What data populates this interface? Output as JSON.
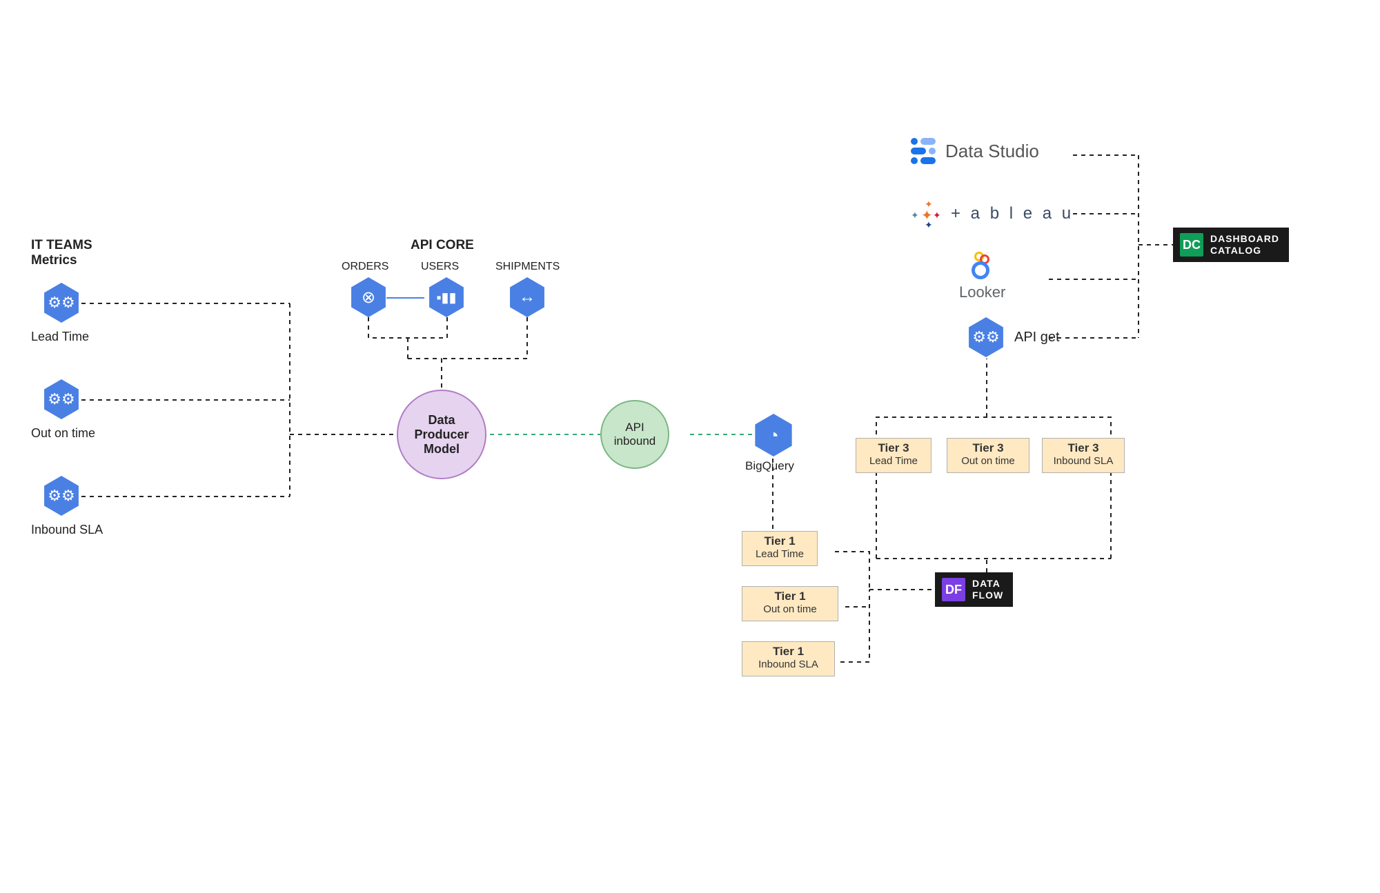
{
  "it_teams": {
    "title_line1": "IT TEAMS",
    "title_line2": "Metrics",
    "metrics": [
      {
        "label": "Lead Time"
      },
      {
        "label": "Out on time"
      },
      {
        "label": "Inbound SLA"
      }
    ]
  },
  "api_core": {
    "title": "API CORE",
    "items": [
      {
        "label": "ORDERS"
      },
      {
        "label": "USERS"
      },
      {
        "label": "SHIPMENTS"
      }
    ]
  },
  "producer": {
    "label_line1": "Data",
    "label_line2": "Producer",
    "label_line3": "Model"
  },
  "api_inbound": {
    "label_line1": "API",
    "label_line2": "inbound"
  },
  "bigquery": {
    "label": "BigQuery"
  },
  "tier1": [
    {
      "tier": "Tier 1",
      "metric": "Lead Time"
    },
    {
      "tier": "Tier 1",
      "metric": "Out on time"
    },
    {
      "tier": "Tier 1",
      "metric": "Inbound SLA"
    }
  ],
  "tier3": [
    {
      "tier": "Tier 3",
      "metric": "Lead Time"
    },
    {
      "tier": "Tier 3",
      "metric": "Out on time"
    },
    {
      "tier": "Tier 3",
      "metric": "Inbound SLA"
    }
  ],
  "dataflow": {
    "badge": "DF",
    "label_line1": "DATA",
    "label_line2": "FLOW"
  },
  "api_get": {
    "label": "API get"
  },
  "tools": {
    "data_studio": "Data Studio",
    "tableau": "+ a b l e a u",
    "looker": "Looker"
  },
  "dashboard_catalog": {
    "badge": "DC",
    "label_line1": "DASHBOARD",
    "label_line2": "CATALOG"
  }
}
